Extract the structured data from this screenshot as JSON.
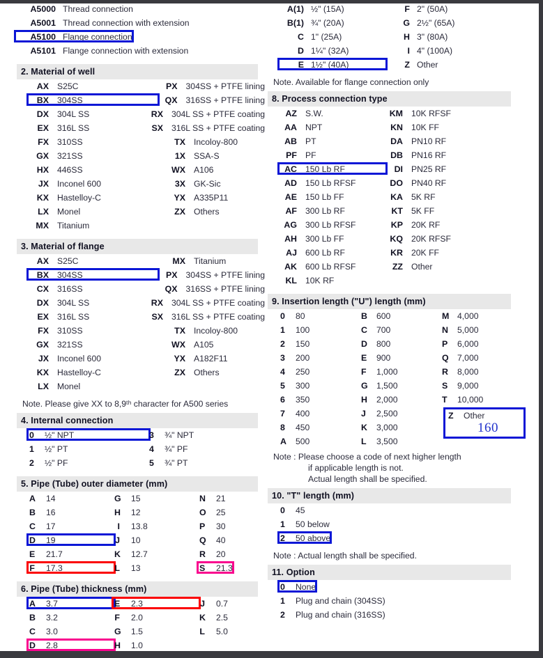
{
  "document": {
    "type": "product-model-code-selection-table",
    "highlight_colors": {
      "blue": "#0B17D6",
      "red": "#FB0103",
      "pink": "#F9048E"
    }
  },
  "top_list": {
    "rows": [
      {
        "code": "A5000",
        "desc": "Thread connection",
        "hl": ""
      },
      {
        "code": "A5001",
        "desc": "Thread connection with extension",
        "hl": ""
      },
      {
        "code": "A5100",
        "desc": "Flange connection",
        "hl": "blue"
      },
      {
        "code": "A5101",
        "desc": "Flange connection with extension",
        "hl": ""
      }
    ]
  },
  "section2": {
    "title": "2. Material of well",
    "rows": [
      {
        "a_code": "AX",
        "a_desc": "S25C",
        "a_hl": "",
        "b_code": "PX",
        "b_desc": "304SS + PTFE lining",
        "b_hl": ""
      },
      {
        "a_code": "BX",
        "a_desc": "304SS",
        "a_hl": "blue",
        "b_code": "QX",
        "b_desc": "316SS + PTFE lining",
        "b_hl": ""
      },
      {
        "a_code": "DX",
        "a_desc": "304L SS",
        "a_hl": "",
        "b_code": "RX",
        "b_desc": "304L SS + PTFE coating",
        "b_hl": ""
      },
      {
        "a_code": "EX",
        "a_desc": "316L SS",
        "a_hl": "",
        "b_code": "SX",
        "b_desc": "316L SS + PTFE coating",
        "b_hl": ""
      },
      {
        "a_code": "FX",
        "a_desc": "310SS",
        "a_hl": "",
        "b_code": "TX",
        "b_desc": "Incoloy-800",
        "b_hl": ""
      },
      {
        "a_code": "GX",
        "a_desc": "321SS",
        "a_hl": "",
        "b_code": "1X",
        "b_desc": "SSA-S",
        "b_hl": ""
      },
      {
        "a_code": "HX",
        "a_desc": "446SS",
        "a_hl": "",
        "b_code": "WX",
        "b_desc": "A106",
        "b_hl": ""
      },
      {
        "a_code": "JX",
        "a_desc": "Inconel 600",
        "a_hl": "",
        "b_code": "3X",
        "b_desc": "GK-Sic",
        "b_hl": ""
      },
      {
        "a_code": "KX",
        "a_desc": "Hastelloy-C",
        "a_hl": "",
        "b_code": "YX",
        "b_desc": "A335P11",
        "b_hl": ""
      },
      {
        "a_code": "LX",
        "a_desc": "Monel",
        "a_hl": "",
        "b_code": "ZX",
        "b_desc": "Others",
        "b_hl": ""
      },
      {
        "a_code": "MX",
        "a_desc": "Titanium",
        "a_hl": "",
        "b_code": "",
        "b_desc": "",
        "b_hl": ""
      }
    ]
  },
  "section3": {
    "title": "3. Material of flange",
    "rows": [
      {
        "a_code": "AX",
        "a_desc": "S25C",
        "a_hl": "",
        "b_code": "MX",
        "b_desc": "Titanium",
        "b_hl": ""
      },
      {
        "a_code": "BX",
        "a_desc": "304SS",
        "a_hl": "blue",
        "b_code": "PX",
        "b_desc": "304SS + PTFE lining",
        "b_hl": ""
      },
      {
        "a_code": "CX",
        "a_desc": "316SS",
        "a_hl": "",
        "b_code": "QX",
        "b_desc": "316SS + PTFE lining",
        "b_hl": ""
      },
      {
        "a_code": "DX",
        "a_desc": "304L SS",
        "a_hl": "",
        "b_code": "RX",
        "b_desc": "304L SS + PTFE coating",
        "b_hl": ""
      },
      {
        "a_code": "EX",
        "a_desc": "316L SS",
        "a_hl": "",
        "b_code": "SX",
        "b_desc": "316L SS + PTFE coating",
        "b_hl": ""
      },
      {
        "a_code": "FX",
        "a_desc": "310SS",
        "a_hl": "",
        "b_code": "TX",
        "b_desc": "Incoloy-800",
        "b_hl": ""
      },
      {
        "a_code": "GX",
        "a_desc": "321SS",
        "a_hl": "",
        "b_code": "WX",
        "b_desc": "A105",
        "b_hl": ""
      },
      {
        "a_code": "JX",
        "a_desc": "Inconel 600",
        "a_hl": "",
        "b_code": "YX",
        "b_desc": "A182F11",
        "b_hl": ""
      },
      {
        "a_code": "KX",
        "a_desc": "Hastelloy-C",
        "a_hl": "",
        "b_code": "ZX",
        "b_desc": "Others",
        "b_hl": ""
      },
      {
        "a_code": "LX",
        "a_desc": "Monel",
        "a_hl": "",
        "b_code": "",
        "b_desc": "",
        "b_hl": ""
      }
    ],
    "note": "Note.  Please give XX to 8,9ᵗʰ character for A500 series"
  },
  "section4": {
    "title": "4. Internal connection",
    "rows": [
      {
        "a_code": "0",
        "a_desc": "½\" NPT",
        "a_hl": "blue",
        "b_code": "3",
        "b_desc": "¾\" NPT",
        "b_hl": ""
      },
      {
        "a_code": "1",
        "a_desc": "½\" PT",
        "a_hl": "",
        "b_code": "4",
        "b_desc": "¾\" PF",
        "b_hl": ""
      },
      {
        "a_code": "2",
        "a_desc": "½\" PF",
        "a_hl": "",
        "b_code": "5",
        "b_desc": "¾\" PT",
        "b_hl": ""
      }
    ]
  },
  "section5": {
    "title": "5. Pipe (Tube) outer diameter (mm)",
    "rows": [
      {
        "a_code": "A",
        "a_desc": "14",
        "a_hl": "",
        "b_code": "G",
        "b_desc": "15",
        "b_hl": "",
        "c_code": "N",
        "c_desc": "21",
        "c_hl": ""
      },
      {
        "a_code": "B",
        "a_desc": "16",
        "a_hl": "",
        "b_code": "H",
        "b_desc": "12",
        "b_hl": "",
        "c_code": "O",
        "c_desc": "25",
        "c_hl": ""
      },
      {
        "a_code": "C",
        "a_desc": "17",
        "a_hl": "",
        "b_code": "I",
        "b_desc": "13.8",
        "b_hl": "",
        "c_code": "P",
        "c_desc": "30",
        "c_hl": ""
      },
      {
        "a_code": "D",
        "a_desc": "19",
        "a_hl": "blue",
        "b_code": "J",
        "b_desc": "10",
        "b_hl": "",
        "c_code": "Q",
        "c_desc": "40",
        "c_hl": ""
      },
      {
        "a_code": "E",
        "a_desc": "21.7",
        "a_hl": "",
        "b_code": "K",
        "b_desc": "12.7",
        "b_hl": "",
        "c_code": "R",
        "c_desc": "20",
        "c_hl": ""
      },
      {
        "a_code": "F",
        "a_desc": "17.3",
        "a_hl": "red",
        "b_code": "L",
        "b_desc": "13",
        "b_hl": "",
        "c_code": "S",
        "c_desc": "21.3",
        "c_hl": "pink"
      }
    ]
  },
  "section6": {
    "title": "6. Pipe (Tube) thickness (mm)",
    "rows": [
      {
        "a_code": "A",
        "a_desc": "3.7",
        "a_hl": "blue",
        "b_code": "E",
        "b_desc": "2.3",
        "b_hl": "red",
        "c_code": "J",
        "c_desc": "0.7",
        "c_hl": ""
      },
      {
        "a_code": "B",
        "a_desc": "3.2",
        "a_hl": "",
        "b_code": "F",
        "b_desc": "2.0",
        "b_hl": "",
        "c_code": "K",
        "c_desc": "2.5",
        "c_hl": ""
      },
      {
        "a_code": "C",
        "a_desc": "3.0",
        "a_hl": "",
        "b_code": "G",
        "b_desc": "1.5",
        "b_hl": "",
        "c_code": "L",
        "c_desc": "5.0",
        "c_hl": ""
      },
      {
        "a_code": "D",
        "a_desc": "2.8",
        "a_hl": "pink",
        "b_code": "H",
        "b_desc": "1.0",
        "b_hl": "",
        "c_code": "",
        "c_desc": "",
        "c_hl": ""
      }
    ]
  },
  "section7": {
    "rows": [
      {
        "a_code": "A(1)",
        "a_desc": "½\" (15A)",
        "a_hl": "",
        "b_code": "F",
        "b_desc": "2\" (50A)",
        "b_hl": ""
      },
      {
        "a_code": "B(1)",
        "a_desc": "¾\" (20A)",
        "a_hl": "",
        "b_code": "G",
        "b_desc": "2½\" (65A)",
        "b_hl": ""
      },
      {
        "a_code": "C",
        "a_desc": "1\" (25A)",
        "a_hl": "",
        "b_code": "H",
        "b_desc": "3\" (80A)",
        "b_hl": ""
      },
      {
        "a_code": "D",
        "a_desc": "1¼\" (32A)",
        "a_hl": "",
        "b_code": "I",
        "b_desc": "4\" (100A)",
        "b_hl": ""
      },
      {
        "a_code": "E",
        "a_desc": "1½\" (40A)",
        "a_hl": "blue",
        "b_code": "Z",
        "b_desc": "Other",
        "b_hl": ""
      }
    ],
    "note": "Note.  Available for flange connection only"
  },
  "section8": {
    "title": "8. Process connection type",
    "rows": [
      {
        "a_code": "AZ",
        "a_desc": "S.W.",
        "a_hl": "",
        "b_code": "KM",
        "b_desc": "10K RFSF",
        "b_hl": ""
      },
      {
        "a_code": "AA",
        "a_desc": "NPT",
        "a_hl": "",
        "b_code": "KN",
        "b_desc": "10K FF",
        "b_hl": ""
      },
      {
        "a_code": "AB",
        "a_desc": "PT",
        "a_hl": "",
        "b_code": "DA",
        "b_desc": "PN10 RF",
        "b_hl": ""
      },
      {
        "a_code": "PF",
        "a_desc": "PF",
        "a_hl": "",
        "b_code": "DB",
        "b_desc": "PN16 RF",
        "b_hl": ""
      },
      {
        "a_code": "AC",
        "a_desc": "150 Lb RF",
        "a_hl": "blue",
        "b_code": "DI",
        "b_desc": "PN25 RF",
        "b_hl": ""
      },
      {
        "a_code": "AD",
        "a_desc": "150 Lb RFSF",
        "a_hl": "",
        "b_code": "DO",
        "b_desc": "PN40 RF",
        "b_hl": ""
      },
      {
        "a_code": "AE",
        "a_desc": "150 Lb FF",
        "a_hl": "",
        "b_code": "KA",
        "b_desc": "5K RF",
        "b_hl": ""
      },
      {
        "a_code": "AF",
        "a_desc": "300 Lb RF",
        "a_hl": "",
        "b_code": "KT",
        "b_desc": "5K FF",
        "b_hl": ""
      },
      {
        "a_code": "AG",
        "a_desc": "300 Lb RFSF",
        "a_hl": "",
        "b_code": "KP",
        "b_desc": "20K RF",
        "b_hl": ""
      },
      {
        "a_code": "AH",
        "a_desc": "300 Lb FF",
        "a_hl": "",
        "b_code": "KQ",
        "b_desc": "20K RFSF",
        "b_hl": ""
      },
      {
        "a_code": "AJ",
        "a_desc": "600 Lb RF",
        "a_hl": "",
        "b_code": "KR",
        "b_desc": "20K FF",
        "b_hl": ""
      },
      {
        "a_code": "AK",
        "a_desc": "600 Lb RFSF",
        "a_hl": "",
        "b_code": "ZZ",
        "b_desc": "Other",
        "b_hl": ""
      },
      {
        "a_code": "KL",
        "a_desc": "10K RF",
        "a_hl": "",
        "b_code": "",
        "b_desc": "",
        "b_hl": ""
      }
    ]
  },
  "section9": {
    "title": "9. Insertion length (\"U\") length (mm)",
    "rows": [
      {
        "a_code": "0",
        "a_desc": "80",
        "b_code": "B",
        "b_desc": "600",
        "c_code": "M",
        "c_desc": "4,000",
        "c_hl": ""
      },
      {
        "a_code": "1",
        "a_desc": "100",
        "b_code": "C",
        "b_desc": "700",
        "c_code": "N",
        "c_desc": "5,000",
        "c_hl": ""
      },
      {
        "a_code": "2",
        "a_desc": "150",
        "b_code": "D",
        "b_desc": "800",
        "c_code": "P",
        "c_desc": "6,000",
        "c_hl": ""
      },
      {
        "a_code": "3",
        "a_desc": "200",
        "b_code": "E",
        "b_desc": "900",
        "c_code": "Q",
        "c_desc": "7,000",
        "c_hl": ""
      },
      {
        "a_code": "4",
        "a_desc": "250",
        "b_code": "F",
        "b_desc": "1,000",
        "c_code": "R",
        "c_desc": "8,000",
        "c_hl": ""
      },
      {
        "a_code": "5",
        "a_desc": "300",
        "b_code": "G",
        "b_desc": "1,500",
        "c_code": "S",
        "c_desc": "9,000",
        "c_hl": ""
      },
      {
        "a_code": "6",
        "a_desc": "350",
        "b_code": "H",
        "b_desc": "2,000",
        "c_code": "T",
        "c_desc": "10,000",
        "c_hl": ""
      },
      {
        "a_code": "7",
        "a_desc": "400",
        "b_code": "J",
        "b_desc": "2,500",
        "c_code": "Z",
        "c_desc": "Other",
        "c_hl": "blue"
      },
      {
        "a_code": "8",
        "a_desc": "450",
        "b_code": "K",
        "b_desc": "3,000",
        "c_code": "",
        "c_desc": "",
        "c_hl": ""
      },
      {
        "a_code": "A",
        "a_desc": "500",
        "b_code": "L",
        "b_desc": "3,500",
        "c_code": "",
        "c_desc": "",
        "c_hl": ""
      }
    ],
    "annotation_value": "160",
    "note_line1": "Note : Please choose a code of next higher length",
    "note_line2": "if applicable length is not.",
    "note_line3": "Actual length shall be specified."
  },
  "section10": {
    "title": "10. \"T\" length (mm)",
    "rows": [
      {
        "code": "0",
        "desc": "45",
        "hl": ""
      },
      {
        "code": "1",
        "desc": "50 below",
        "hl": ""
      },
      {
        "code": "2",
        "desc": "50 above",
        "hl": "blue"
      }
    ],
    "note": "Note : Actual length shall be specified."
  },
  "section11": {
    "title": "11. Option",
    "rows": [
      {
        "code": "0",
        "desc": "None",
        "hl": "blue"
      },
      {
        "code": "1",
        "desc": "Plug and chain (304SS)",
        "hl": ""
      },
      {
        "code": "2",
        "desc": "Plug and chain (316SS)",
        "hl": ""
      }
    ]
  }
}
